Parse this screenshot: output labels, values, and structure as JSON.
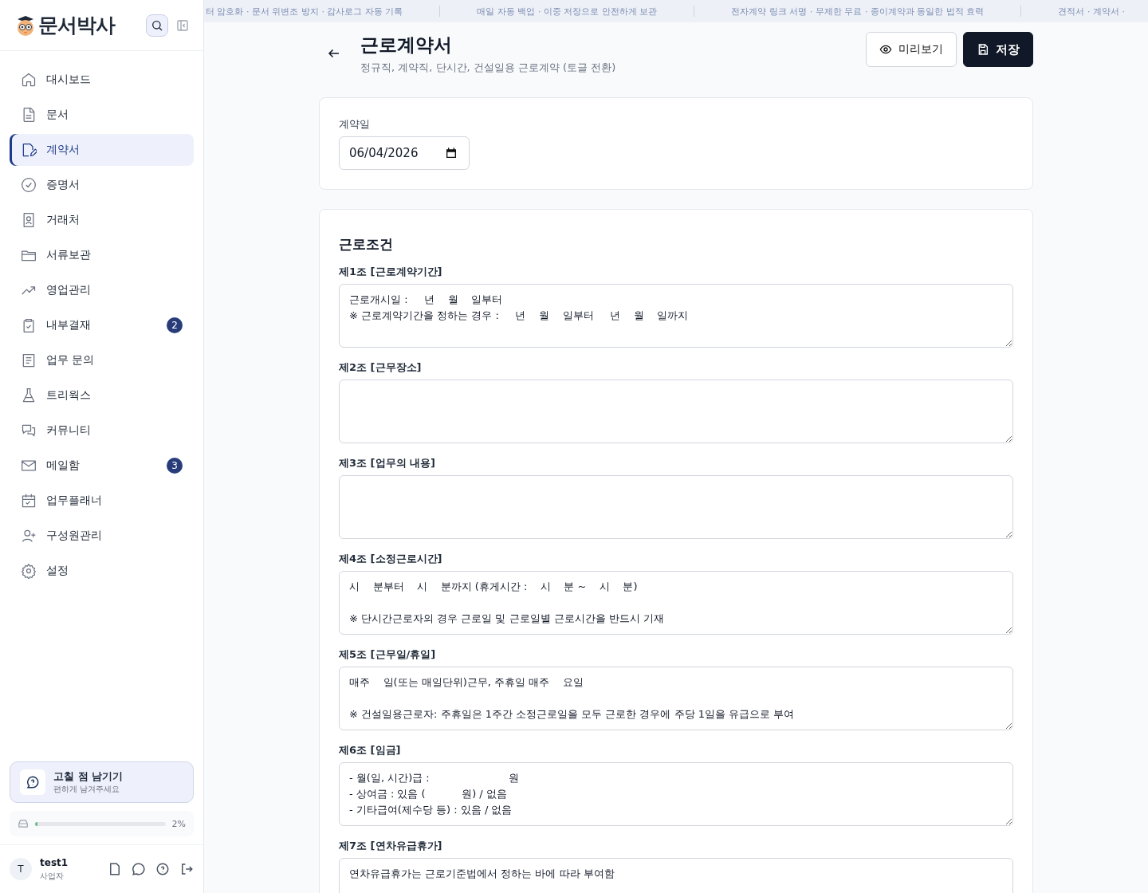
{
  "sidebar": {
    "logo": "문서박사",
    "nav": [
      {
        "label": "대시보드",
        "selected": false
      },
      {
        "label": "문서",
        "selected": false
      },
      {
        "label": "계약서",
        "selected": true
      },
      {
        "label": "증명서",
        "selected": false
      },
      {
        "label": "거래처",
        "selected": false
      },
      {
        "label": "서류보관",
        "selected": false
      },
      {
        "label": "영업관리",
        "selected": false
      },
      {
        "label": "내부결재",
        "selected": false,
        "badge": "2"
      },
      {
        "label": "업무 문의",
        "selected": false
      },
      {
        "label": "트리웍스",
        "selected": false
      },
      {
        "label": "커뮤니티",
        "selected": false
      },
      {
        "label": "메일함",
        "selected": false,
        "badge": "3"
      },
      {
        "label": "업무플래너",
        "selected": false
      },
      {
        "label": "구성원관리",
        "selected": false
      },
      {
        "label": "설정",
        "selected": false
      }
    ],
    "feedback": {
      "title": "고칠 점 남기기",
      "subtitle": "편하게 남겨주세요"
    },
    "storage": {
      "level": 0.02,
      "reading": "2%"
    },
    "user": {
      "initial": "T",
      "name": "test1",
      "role": "사업자"
    }
  },
  "ticker": [
    "터 암호화 · 문서 위변조 방지 · 감사로그 자동 기록",
    "매일 자동 백업 · 이중 저장으로 안전하게 보관",
    "전자계약 링크 서명 · 무제한 무료 · 종이계약과 동일한 법적 효력",
    "견적서 · 계약서 ·"
  ],
  "header": {
    "title": "근로계약서",
    "subtitle": "정규직, 계약직, 단시간, 건설일용 근로계약 (토글 전환)",
    "buttons": [
      {
        "label": "미리보기",
        "kind": "secondary"
      },
      {
        "label": "저장",
        "kind": "primary"
      }
    ]
  },
  "contract_date": {
    "label": "계약일",
    "value": "06/04/2026"
  },
  "terms": {
    "title": "근로조건",
    "articles": [
      {
        "label": "제1조 [근로계약기간]",
        "value": "근로개시일 :     년    월    일부터\n※ 근로계약기간을 정하는 경우 :     년    월    일부터     년    월    일까지"
      },
      {
        "label": "제2조 [근무장소]"
      },
      {
        "label": "제3조 [업무의 내용]"
      },
      {
        "label": "제4조 [소정근로시간]",
        "value": "시    분부터    시    분까지 (휴게시간 :    시    분 ~    시    분)\n\n※ 단시간근로자의 경우 근로일 및 근로일별 근로시간을 반드시 기재"
      },
      {
        "label": "제5조 [근무일/휴일]",
        "value": "매주    일(또는 매일단위)근무, 주휴일 매주    요일\n\n※ 건설일용근로자: 주휴일은 1주간 소정근로일을 모두 근로한 경우에 주당 1일을 유급으로 부여"
      },
      {
        "label": "제6조 [임금]",
        "value": "- 월(일, 시간)급 :                        원\n- 상여금 : 있음 (           원) / 없음\n- 기타급여(제수당 등) : 있음 / 없음"
      },
      {
        "label": "제7조 [연차유급휴가]",
        "value": "연차유급휴가는 근로기준법에서 정하는 바에 따라 부여함"
      }
    ]
  }
}
